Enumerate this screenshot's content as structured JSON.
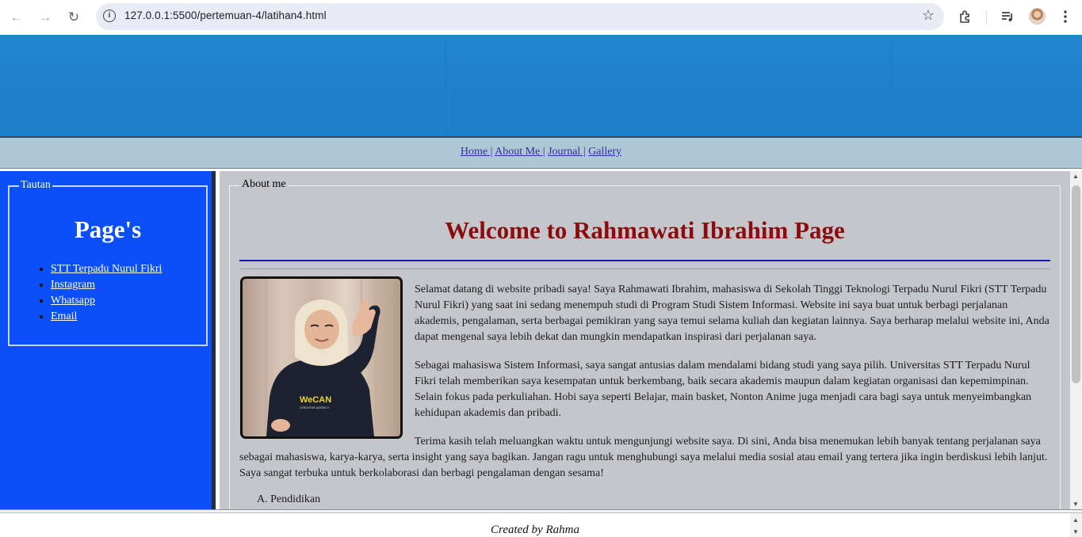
{
  "browser": {
    "url": "127.0.0.1:5500/pertemuan-4/latihan4.html",
    "back": "←",
    "forward": "→",
    "reload": "↻",
    "info": "i",
    "star": "☆"
  },
  "nav": {
    "links": [
      "Home |",
      "About Me |",
      "Journal |",
      "Gallery"
    ]
  },
  "sidebar": {
    "legend": "Tautan",
    "title": "Page's",
    "links": [
      "STT Terpadu Nurul Fikri",
      "Instagram",
      "Whatsapp",
      "Email"
    ]
  },
  "content": {
    "legend": "About me",
    "heading": "Welcome to Rahmawati Ibrahim Page",
    "paragraphs": [
      "Selamat datang di website pribadi saya! Saya Rahmawati Ibrahim, mahasiswa di Sekolah Tinggi Teknologi Terpadu Nurul Fikri (STT Terpadu Nurul Fikri) yang saat ini sedang menempuh studi di Program Studi Sistem Informasi. Website ini saya buat untuk berbagi perjalanan akademis, pengalaman, serta berbagai pemikiran yang saya temui selama kuliah dan kegiatan lainnya. Saya berharap melalui website ini, Anda dapat mengenal saya lebih dekat dan mungkin mendapatkan inspirasi dari perjalanan saya.",
      "Sebagai mahasiswa Sistem Informasi, saya sangat antusias dalam mendalami bidang studi yang saya pilih. Universitas STT Terpadu Nurul Fikri telah memberikan saya kesempatan untuk berkembang, baik secara akademis maupun dalam kegiatan organisasi dan kepemimpinan. Selain fokus pada perkuliahan. Hobi saya seperti Belajar, main basket, Nonton Anime juga menjadi cara bagi saya untuk menyeimbangkan kehidupan akademis dan pribadi.",
      "Terima kasih telah meluangkan waktu untuk mengunjungi website saya. Di sini, Anda bisa menemukan lebih banyak tentang perjalanan saya sebagai mahasiswa, karya-karya, serta insight yang saya bagikan. Jangan ragu untuk menghubungi saya melalui media sosial atau email yang tertera jika ingin berdiskusi lebih lanjut. Saya sangat terbuka untuk berkolaborasi dan berbagi pengalaman dengan sesama!"
    ],
    "list_item": "A.  Pendidikan",
    "shirt_logo": "WeCAN",
    "shirt_sub": "CREATIVE AGENCY"
  },
  "footer": {
    "text": "Created by Rahma"
  },
  "colors": {
    "banner": "#2286d1",
    "sidebar": "#0a4ff7",
    "heading": "#8b0c0c",
    "content_bg": "#c4c6cb"
  }
}
